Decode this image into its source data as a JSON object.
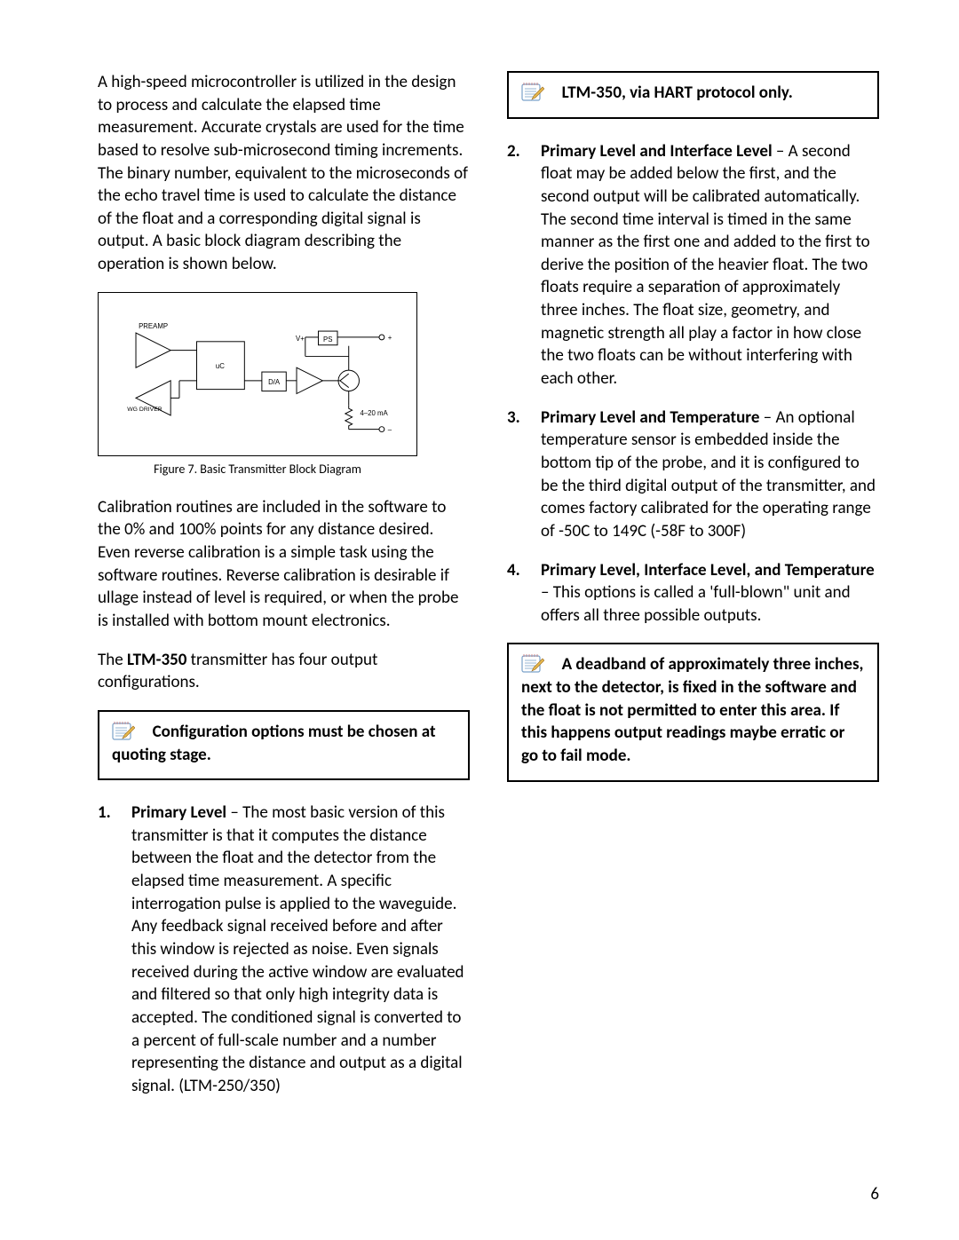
{
  "left": {
    "intro": "A high-speed microcontroller is utilized in the design to process and calculate the elapsed time measurement.  Accurate crystals are used for the time based to resolve sub-microsecond timing increments.  The binary number, equivalent to the microseconds of the echo travel time is used to calculate the distance of the float and a corresponding digital signal is output.  A basic block diagram describing the operation is shown below.",
    "figure": {
      "caption": "Figure 7.  Basic Transmitter Block Diagram",
      "labels": {
        "preamp": "PREAMP",
        "uc": "uC",
        "da": "D/A",
        "ps": "PS",
        "vplus": "V+",
        "wg": "WG DRIVER",
        "out": "4–20 mA",
        "plus": "+",
        "minus": "–"
      }
    },
    "calibration": "Calibration routines are included in the software to the 0% and 100% points for any distance desired. Even reverse calibration is a simple task using the software routines.  Reverse calibration is desirable if ullage instead of level is required, or when the probe is installed with bottom mount electronics.",
    "configs_intro_pre": "The ",
    "configs_intro_model": "LTM-350",
    "configs_intro_post": " transmitter has four output configurations.",
    "note1": "Configuration options must be chosen at quoting stage.",
    "item1_title": "Primary Level",
    "item1_body": " – The most basic version of this transmitter is that it computes the distance between the float and the detector from the elapsed time measurement.  A specific interrogation pulse is applied to the waveguide. Any feedback signal received before and after this window is rejected as noise.  Even signals received during the active window are evaluated and filtered so that only high integrity data is accepted.  The conditioned signal is converted to a percent of full-scale number and a number representing the distance and output as a digital signal. (LTM-250/350)"
  },
  "right": {
    "note_top": "LTM-350, via HART protocol only.",
    "item2_title": "Primary Level and Interface Level",
    "item2_body": " – A second float may be added below the first, and the second output will be calibrated automatically. The second time interval is timed in the same manner as the first one and added to the first to derive the position of the heavier float. The two floats require a separation of approximately three inches.  The float size, geometry, and magnetic strength all play a factor in how close the two floats can be without interfering with each other.",
    "item3_title": "Primary Level and Temperature",
    "item3_body": " – An optional temperature sensor is embedded inside the bottom tip of the probe, and it is configured to be the third digital output of the transmitter, and comes factory calibrated for the operating range of  -50C to 149C (-58F to 300F)",
    "item4_title": "Primary Level, Interface Level, and Temperature",
    "item4_body": " – This options is called a 'full-blown\" unit and offers all three possible outputs.",
    "note_bottom": "A deadband of approximately three inches, next to the detector, is fixed in the software and the float is not permitted to enter this area.  If this happens output readings maybe erratic or go to fail mode."
  },
  "page_number": "6"
}
